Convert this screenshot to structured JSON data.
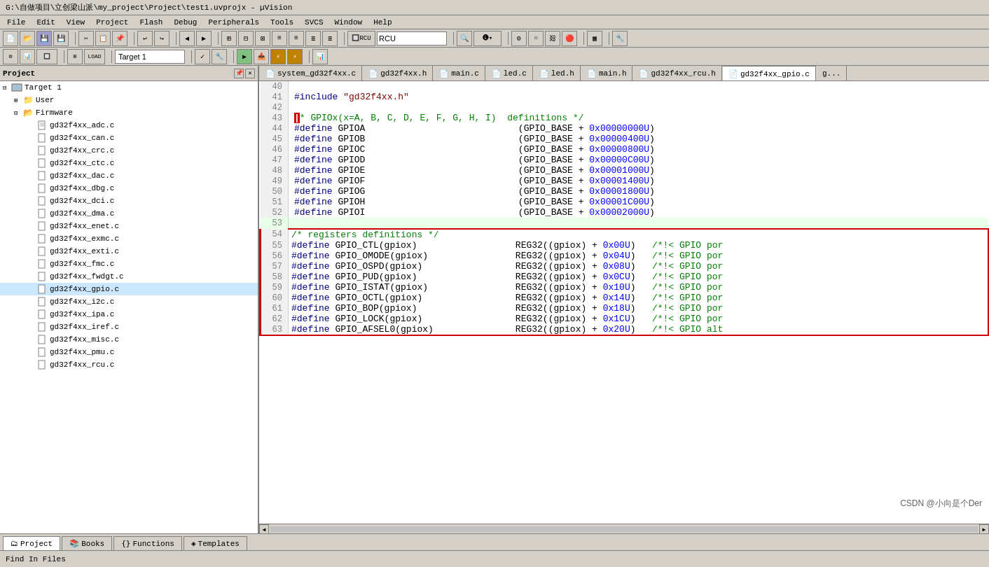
{
  "titlebar": {
    "text": "G:\\自做项目\\立创梁山派\\my_project\\Project\\test1.uvprojx - µVision"
  },
  "menubar": {
    "items": [
      "File",
      "Edit",
      "View",
      "Project",
      "Flash",
      "Debug",
      "Peripherals",
      "Tools",
      "SVCS",
      "Window",
      "Help"
    ]
  },
  "toolbar2": {
    "target_label": "Target 1"
  },
  "sidebar": {
    "title": "Project",
    "tree": [
      {
        "indent": 0,
        "type": "root",
        "label": "Target 1",
        "expanded": true
      },
      {
        "indent": 1,
        "type": "folder",
        "label": "User",
        "expanded": true
      },
      {
        "indent": 1,
        "type": "folder",
        "label": "Firmware",
        "expanded": true
      },
      {
        "indent": 2,
        "type": "file",
        "label": "gd32f4xx_adc.c"
      },
      {
        "indent": 2,
        "type": "file",
        "label": "gd32f4xx_can.c"
      },
      {
        "indent": 2,
        "type": "file",
        "label": "gd32f4xx_crc.c"
      },
      {
        "indent": 2,
        "type": "file",
        "label": "gd32f4xx_ctc.c"
      },
      {
        "indent": 2,
        "type": "file",
        "label": "gd32f4xx_dac.c"
      },
      {
        "indent": 2,
        "type": "file",
        "label": "gd32f4xx_dbg.c"
      },
      {
        "indent": 2,
        "type": "file",
        "label": "gd32f4xx_dci.c"
      },
      {
        "indent": 2,
        "type": "file",
        "label": "gd32f4xx_dma.c"
      },
      {
        "indent": 2,
        "type": "file",
        "label": "gd32f4xx_enet.c"
      },
      {
        "indent": 2,
        "type": "file",
        "label": "gd32f4xx_exmc.c"
      },
      {
        "indent": 2,
        "type": "file",
        "label": "gd32f4xx_exti.c"
      },
      {
        "indent": 2,
        "type": "file",
        "label": "gd32f4xx_fmc.c"
      },
      {
        "indent": 2,
        "type": "file",
        "label": "gd32f4xx_fwdgt.c"
      },
      {
        "indent": 2,
        "type": "file",
        "label": "gd32f4xx_gpio.c",
        "selected": true
      },
      {
        "indent": 2,
        "type": "file",
        "label": "gd32f4xx_i2c.c"
      },
      {
        "indent": 2,
        "type": "file",
        "label": "gd32f4xx_ipa.c"
      },
      {
        "indent": 2,
        "type": "file",
        "label": "gd32f4xx_iref.c"
      },
      {
        "indent": 2,
        "type": "file",
        "label": "gd32f4xx_misc.c"
      },
      {
        "indent": 2,
        "type": "file",
        "label": "gd32f4xx_pmu.c"
      },
      {
        "indent": 2,
        "type": "file",
        "label": "gd32f4xx_rcu.c"
      }
    ]
  },
  "tabs": [
    {
      "label": "system_gd32f4xx.c",
      "active": false
    },
    {
      "label": "gd32f4xx.h",
      "active": false
    },
    {
      "label": "main.c",
      "active": false
    },
    {
      "label": "led.c",
      "active": false
    },
    {
      "label": "led.h",
      "active": false
    },
    {
      "label": "main.h",
      "active": false
    },
    {
      "label": "gd32f4xx_rcu.h",
      "active": false
    },
    {
      "label": "gd32f4xx_gpio.c",
      "active": true
    },
    {
      "label": "g...",
      "active": false
    }
  ],
  "code_lines": [
    {
      "num": 40,
      "code": "",
      "type": "normal"
    },
    {
      "num": 41,
      "code": "#include \"gd32f4xx.h\"",
      "type": "normal"
    },
    {
      "num": 42,
      "code": "",
      "type": "normal"
    },
    {
      "num": 43,
      "code": "/* GPIOx(x=A, B, C, D, E, F, G, H, I)  definitions */",
      "type": "cursor"
    },
    {
      "num": 44,
      "code": "#define GPIOA                            (GPIO_BASE + 0x00000000U)",
      "type": "normal"
    },
    {
      "num": 45,
      "code": "#define GPIOB                            (GPIO_BASE + 0x00000400U)",
      "type": "normal"
    },
    {
      "num": 46,
      "code": "#define GPIOC                            (GPIO_BASE + 0x00000800U)",
      "type": "normal"
    },
    {
      "num": 47,
      "code": "#define GPIOD                            (GPIO_BASE + 0x00000C00U)",
      "type": "normal"
    },
    {
      "num": 48,
      "code": "#define GPIOE                            (GPIO_BASE + 0x00001000U)",
      "type": "normal"
    },
    {
      "num": 49,
      "code": "#define GPIOF                            (GPIO_BASE + 0x00001400U)",
      "type": "normal"
    },
    {
      "num": 50,
      "code": "#define GPIOG                            (GPIO_BASE + 0x00001800U)",
      "type": "normal"
    },
    {
      "num": 51,
      "code": "#define GPIOH                            (GPIO_BASE + 0x00001C00U)",
      "type": "normal"
    },
    {
      "num": 52,
      "code": "#define GPIOI                            (GPIO_BASE + 0x00002000U)",
      "type": "normal"
    },
    {
      "num": 53,
      "code": "",
      "type": "highlighted"
    },
    {
      "num": 54,
      "code": "/* registers definitions */",
      "type": "boxed"
    },
    {
      "num": 55,
      "code": "#define GPIO_CTL(gpiox)                  REG32((gpiox) + 0x00U)   /*!< GPIO por",
      "type": "boxed"
    },
    {
      "num": 56,
      "code": "#define GPIO_OMODE(gpiox)                REG32((gpiox) + 0x04U)   /*!< GPIO por",
      "type": "boxed"
    },
    {
      "num": 57,
      "code": "#define GPIO_OSPD(gpiox)                 REG32((gpiox) + 0x08U)   /*!< GPIO por",
      "type": "boxed"
    },
    {
      "num": 58,
      "code": "#define GPIO_PUD(gpiox)                  REG32((gpiox) + 0x0CU)   /*!< GPIO por",
      "type": "boxed"
    },
    {
      "num": 59,
      "code": "#define GPIO_ISTAT(gpiox)                REG32((gpiox) + 0x10U)   /*!< GPIO por",
      "type": "boxed"
    },
    {
      "num": 60,
      "code": "#define GPIO_OCTL(gpiox)                 REG32((gpiox) + 0x14U)   /*!< GPIO por",
      "type": "boxed"
    },
    {
      "num": 61,
      "code": "#define GPIO_BOP(gpiox)                  REG32((gpiox) + 0x18U)   /*!< GPIO por",
      "type": "boxed"
    },
    {
      "num": 62,
      "code": "#define GPIO_LOCK(gpiox)                 REG32((gpiox) + 0x1CU)   /*!< GPIO por",
      "type": "boxed"
    },
    {
      "num": 63,
      "code": "#define GPIO_AFSEL0(gpiox)               REG32((gpiox) + 0x20U)   /*!< GPIO alt",
      "type": "boxed"
    }
  ],
  "bottom_tabs": [
    {
      "label": "Project",
      "active": true,
      "icon": "project"
    },
    {
      "label": "Books",
      "active": false,
      "icon": "books"
    },
    {
      "label": "Functions",
      "active": false,
      "icon": "functions"
    },
    {
      "label": "Templates",
      "active": false,
      "icon": "templates"
    }
  ],
  "find_bar": {
    "label": "Find In Files"
  },
  "status_bar": {
    "left": "",
    "right": "CSDN @小向是个Der"
  },
  "colors": {
    "accent": "#316ac5",
    "boxed_border": "#cc0000"
  }
}
